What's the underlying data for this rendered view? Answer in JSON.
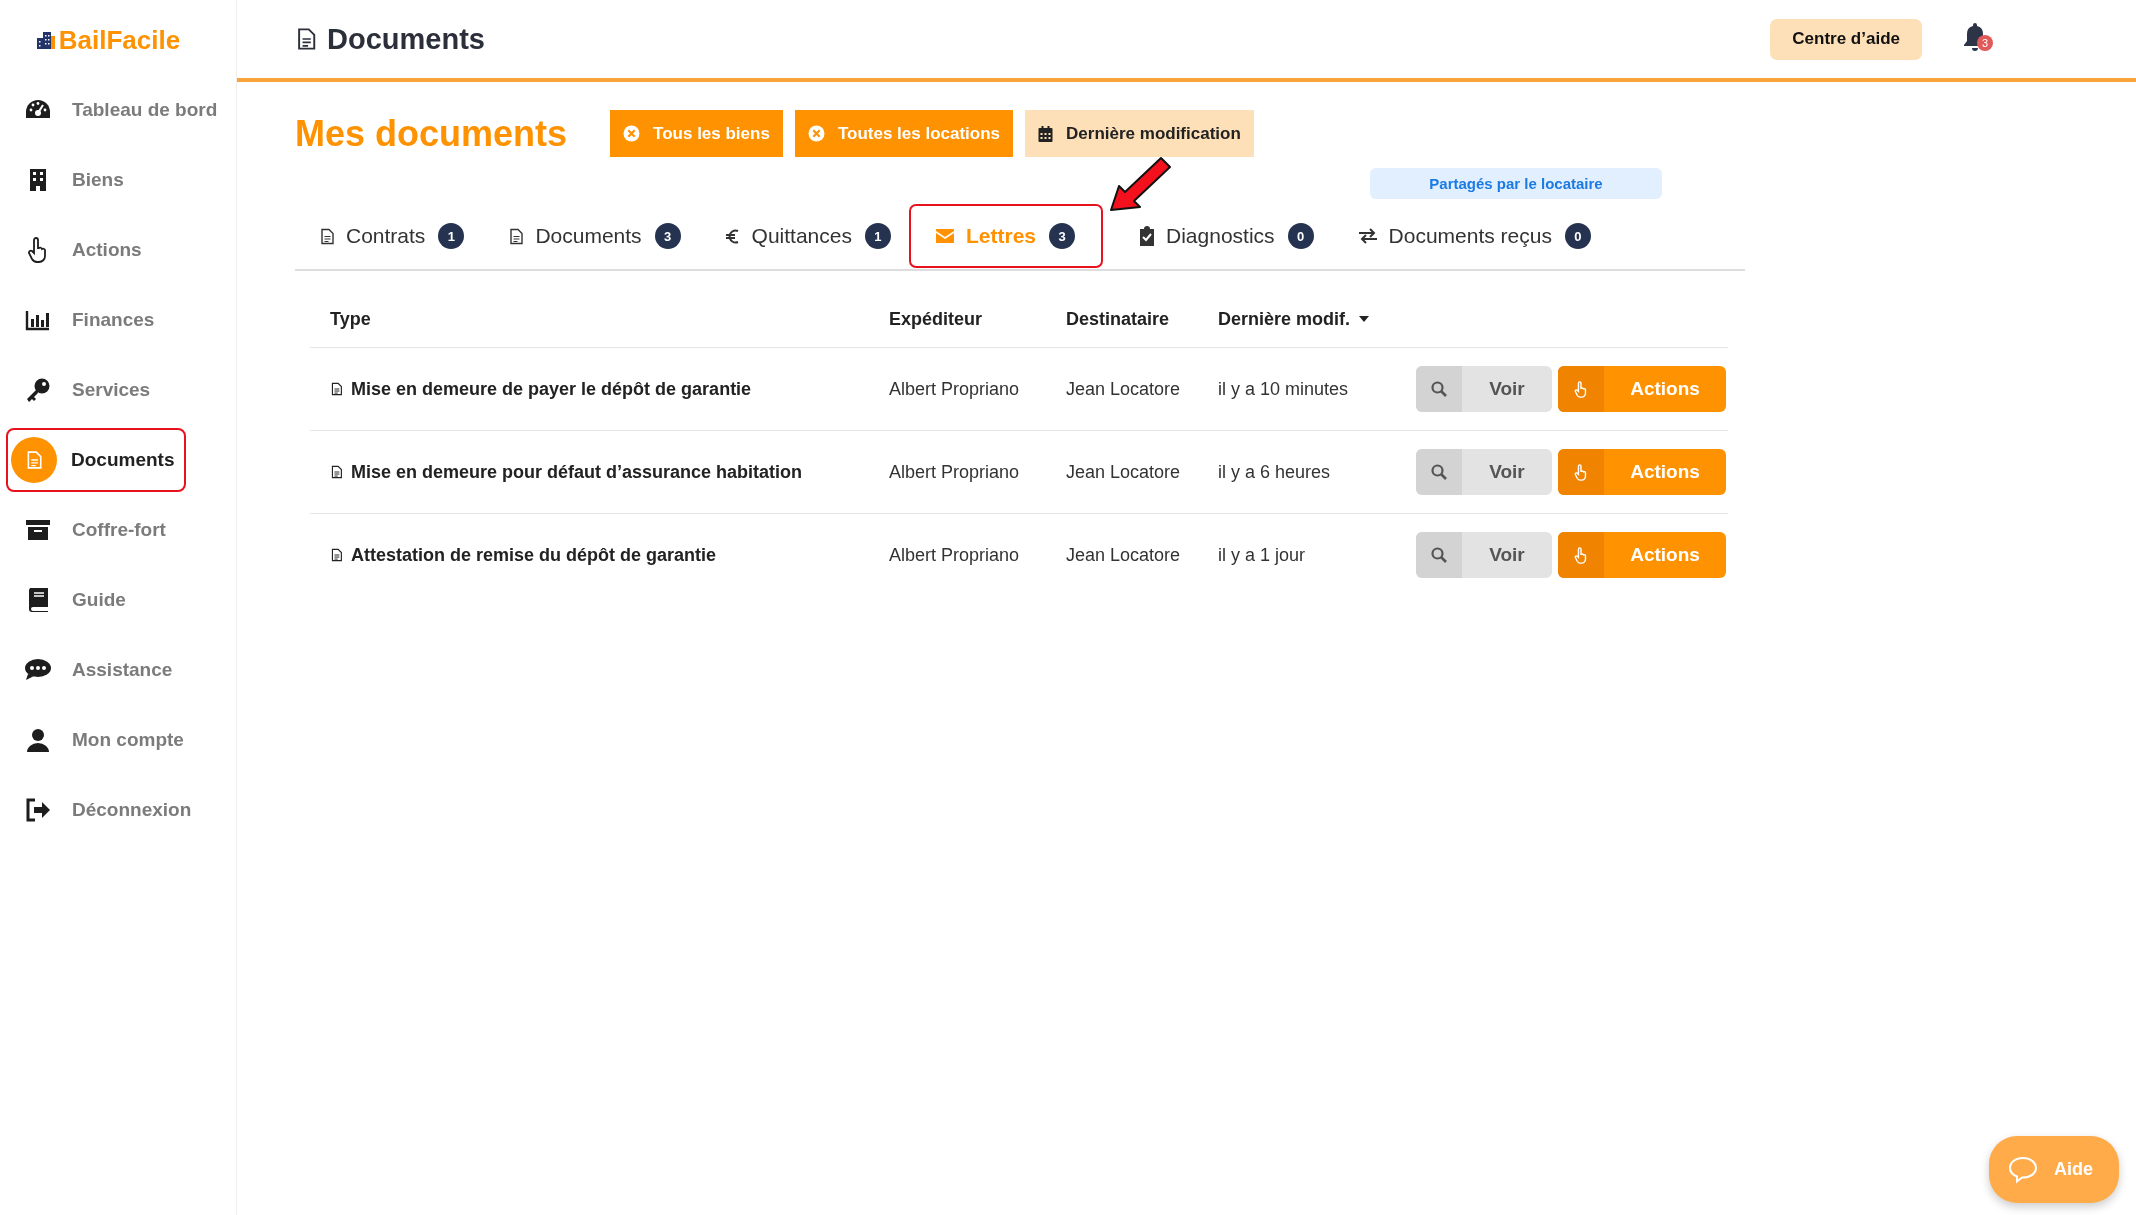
{
  "app": {
    "logo": "BailFacile"
  },
  "sidebar": {
    "items": [
      {
        "label": "Tableau de bord",
        "selected": false,
        "highlighted": false
      },
      {
        "label": "Biens",
        "selected": false,
        "highlighted": false
      },
      {
        "label": "Actions",
        "selected": false,
        "highlighted": false
      },
      {
        "label": "Finances",
        "selected": false,
        "highlighted": false
      },
      {
        "label": "Services",
        "selected": false,
        "highlighted": false
      },
      {
        "label": "Documents",
        "selected": true,
        "highlighted": true
      },
      {
        "label": "Coffre-fort",
        "selected": false,
        "highlighted": false
      },
      {
        "label": "Guide",
        "selected": false,
        "highlighted": false
      },
      {
        "label": "Assistance",
        "selected": false,
        "highlighted": false
      },
      {
        "label": "Mon compte",
        "selected": false,
        "highlighted": false
      },
      {
        "label": "Déconnexion",
        "selected": false,
        "highlighted": false
      }
    ]
  },
  "header": {
    "title": "Documents",
    "help_button": "Centre d’aide",
    "notifications": {
      "count": "3"
    }
  },
  "page": {
    "title": "Mes documents",
    "filters": [
      {
        "label": "Tous les biens",
        "kind": "clear"
      },
      {
        "label": "Toutes les locations",
        "kind": "clear"
      },
      {
        "label": "Dernière modification",
        "kind": "sort"
      }
    ]
  },
  "shared_badge": "Partagés par le locataire",
  "tabs": [
    {
      "label": "Contrats",
      "count": "1",
      "selected": false,
      "highlighted": false,
      "arrow": false
    },
    {
      "label": "Documents",
      "count": "3",
      "selected": false,
      "highlighted": false,
      "arrow": false
    },
    {
      "label": "Quittances",
      "count": "1",
      "selected": false,
      "highlighted": false,
      "arrow": false
    },
    {
      "label": "Lettres",
      "count": "3",
      "selected": true,
      "highlighted": true,
      "arrow": true
    },
    {
      "label": "Diagnostics",
      "count": "0",
      "selected": false,
      "highlighted": false,
      "arrow": false
    },
    {
      "label": "Documents reçus",
      "count": "0",
      "selected": false,
      "highlighted": false,
      "arrow": false
    }
  ],
  "table": {
    "columns": [
      {
        "label": "Type",
        "sorted": false
      },
      {
        "label": "Expéditeur",
        "sorted": false
      },
      {
        "label": "Destinataire",
        "sorted": false
      },
      {
        "label": "Dernière modif.",
        "sorted": true
      }
    ],
    "rows": [
      {
        "type": "Mise en demeure de payer le dépôt de garantie",
        "sender": "Albert Propriano",
        "recipient": "Jean Locatore",
        "modified": "il y a 10 minutes",
        "view_button": "Voir",
        "actions_button": "Actions"
      },
      {
        "type": "Mise en demeure pour défaut d’assurance habitation",
        "sender": "Albert Propriano",
        "recipient": "Jean Locatore",
        "modified": "il y a 6 heures",
        "view_button": "Voir",
        "actions_button": "Actions"
      },
      {
        "type": "Attestation de remise du dépôt de garantie",
        "sender": "Albert Propriano",
        "recipient": "Jean Locatore",
        "modified": "il y a 1 jour",
        "view_button": "Voir",
        "actions_button": "Actions"
      }
    ]
  },
  "help_fab": {
    "label": "Aide"
  }
}
